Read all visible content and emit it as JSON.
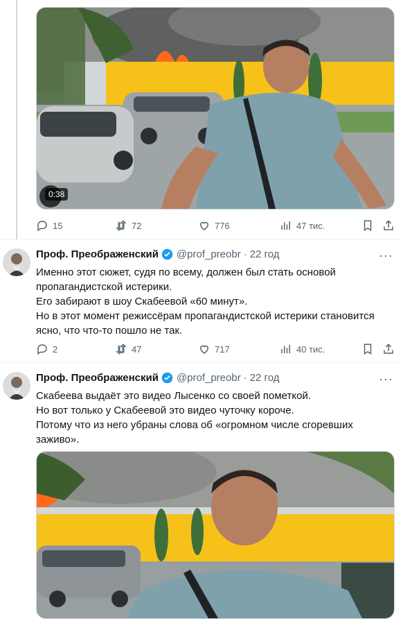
{
  "top_video": {
    "duration": "0:38"
  },
  "top_actions": {
    "replies": "15",
    "retweets": "72",
    "likes": "776",
    "views": "47 тис."
  },
  "tweet1": {
    "author": "Проф. Преображенский",
    "handle": "@prof_preobr",
    "separator": "·",
    "time": "22 год",
    "more": "···",
    "lines": [
      "Именно этот сюжет, судя по всему, должен был стать основой пропагандистской истерики.",
      "Его забирают в шоу Скабеевой «60 минут».",
      "Но в этот момент режиссёрам пропагандистской истерики становится ясно, что что-то пошло не так."
    ],
    "actions": {
      "replies": "2",
      "retweets": "47",
      "likes": "717",
      "views": "40 тис."
    }
  },
  "tweet2": {
    "author": "Проф. Преображенский",
    "handle": "@prof_preobr",
    "separator": "·",
    "time": "22 год",
    "more": "···",
    "lines": [
      "Скабеева выдаёт это видео Лысенко со своей пометкой.",
      "Но вот только у Скабеевой это видео чуточку короче.",
      "Потому что из него убраны слова об «огромном числе сгоревших заживо»."
    ]
  },
  "colors": {
    "verified": "#1d9bf0",
    "muted": "#536471",
    "wall": "#f6c21a",
    "fire": "#ff6a1a"
  },
  "icons": [
    "reply-icon",
    "retweet-icon",
    "like-icon",
    "views-icon",
    "bookmark-icon",
    "share-icon",
    "verified-badge-icon"
  ]
}
